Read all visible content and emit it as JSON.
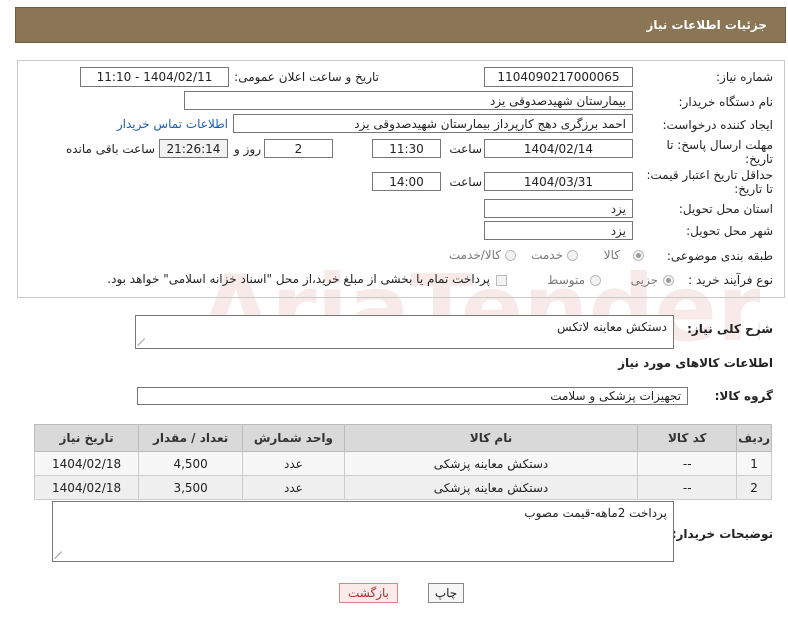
{
  "header": {
    "title": "جزئیات اطلاعات نیاز"
  },
  "form": {
    "need_number_label": "شماره نیاز:",
    "need_number": "1104090217000065",
    "announce_label": "تاریخ و ساعت اعلان عمومی:",
    "announce_value": "1404/02/11 - 11:10",
    "buyer_label": "نام دستگاه خریدار:",
    "buyer_value": "بیمارستان شهیدصدوقی یزد",
    "creator_label": "ایجاد کننده درخواست:",
    "creator_value": "احمد برزگری دهج کارپرداز بیمارستان شهیدصدوقی یزد",
    "contact_link": "اطلاعات تماس خریدار",
    "deadline_label_1": "مهلت ارسال پاسخ: تا",
    "deadline_label_2": "تاریخ:",
    "deadline_date": "1404/02/14",
    "time_label": "ساعت",
    "deadline_time": "11:30",
    "days_value": "2",
    "days_label": "روز و",
    "remaining_time": "21:26:14",
    "remaining_label": "ساعت باقی مانده",
    "validity_label_1": "حداقل تاریخ اعتبار قیمت:",
    "validity_label_2": "تا تاریخ:",
    "validity_date": "1404/03/31",
    "validity_time": "14:00",
    "province_label": "استان محل تحویل:",
    "province_value": "یزد",
    "city_label": "شهر محل تحویل:",
    "city_value": "یزد",
    "category_label": "طبقه بندی موضوعی:",
    "category_options": [
      "کالا",
      "خدمت",
      "کالا/خدمت"
    ],
    "process_label": "نوع فرآیند خرید :",
    "process_options": [
      "جزیی",
      "متوسط"
    ],
    "payment_note": "پرداخت تمام یا بخشی از مبلغ خرید،از محل \"اسناد خزانه اسلامی\" خواهد بود."
  },
  "description": {
    "label": "شرح کلی نیاز:",
    "value": "دستکش معاینه لاتکس"
  },
  "items_section": {
    "title": "اطلاعات کالاهای مورد نیاز",
    "group_label": "گروه کالا:",
    "group_value": "تجهیزات پزشکی و سلامت",
    "columns": [
      "ردیف",
      "کد کالا",
      "نام کالا",
      "واحد شمارش",
      "تعداد / مقدار",
      "تاریخ نیاز"
    ],
    "rows": [
      [
        "1",
        "--",
        "دستکش معاینه پزشکی",
        "عدد",
        "4,500",
        "1404/02/18"
      ],
      [
        "2",
        "--",
        "دستکش معاینه پزشکی",
        "عدد",
        "3,500",
        "1404/02/18"
      ]
    ]
  },
  "buyer_notes": {
    "label": "توضیحات خریدار:",
    "value": "پرداخت 2ماهه-قیمت مصوب"
  },
  "buttons": {
    "print": "چاپ",
    "back": "بازگشت"
  },
  "watermark": {
    "text": "AriaTender.neT"
  }
}
